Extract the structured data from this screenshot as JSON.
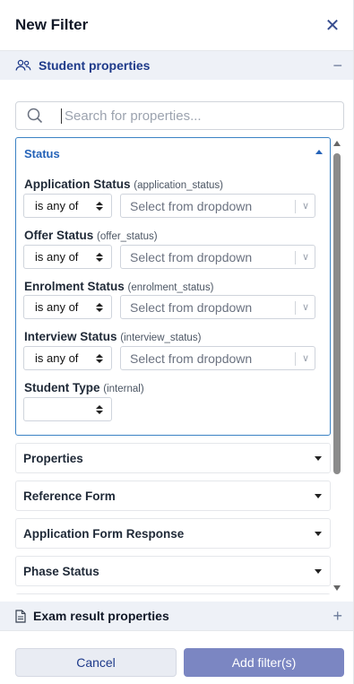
{
  "header": {
    "title": "New Filter",
    "close_icon": "close-icon"
  },
  "student_section": {
    "label": "Student properties",
    "icon": "users-icon",
    "toggle": "−"
  },
  "search": {
    "placeholder": "Search for properties..."
  },
  "status_group": {
    "title": "Status",
    "fields": [
      {
        "label": "Application Status",
        "key": "(application_status)",
        "operator": "is any of",
        "placeholder": "Select from dropdown"
      },
      {
        "label": "Offer Status",
        "key": "(offer_status)",
        "operator": "is any of",
        "placeholder": "Select from dropdown"
      },
      {
        "label": "Enrolment Status",
        "key": "(enrolment_status)",
        "operator": "is any of",
        "placeholder": "Select from dropdown"
      },
      {
        "label": "Interview Status",
        "key": "(interview_status)",
        "operator": "is any of",
        "placeholder": "Select from dropdown"
      }
    ],
    "student_type": {
      "label": "Student Type",
      "key": "(internal)"
    }
  },
  "groups": [
    {
      "label": "Properties"
    },
    {
      "label": "Reference Form"
    },
    {
      "label": "Application Form Response"
    },
    {
      "label": "Phase Status"
    }
  ],
  "exam_section": {
    "label": "Exam result properties",
    "icon": "document-icon",
    "toggle": "+"
  },
  "footer": {
    "cancel": "Cancel",
    "add": "Add filter(s)"
  },
  "colors": {
    "accent": "#2563b8",
    "primary_button": "#7b86c2",
    "section_bg": "#eef1f7"
  }
}
